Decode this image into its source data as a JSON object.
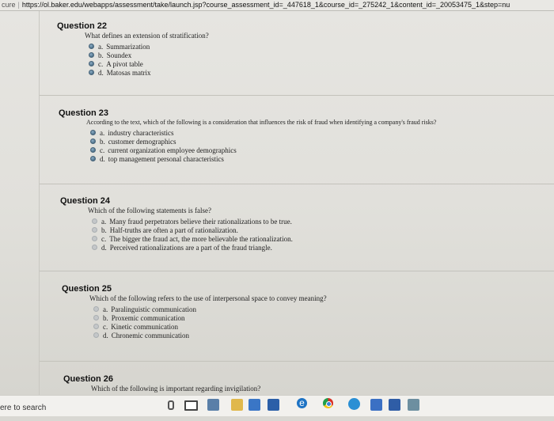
{
  "browser": {
    "secure_label": "cure",
    "url": "https://ol.baker.edu/webapps/assessment/take/launch.jsp?course_assessment_id=_447618_1&course_id=_275242_1&content_id=_20053475_1&step=nu"
  },
  "questions": [
    {
      "title": "Question 22",
      "text": "What defines an extension of stratification?",
      "options": [
        {
          "letter": "a.",
          "text": "Summarization"
        },
        {
          "letter": "b.",
          "text": "Soundex"
        },
        {
          "letter": "c.",
          "text": "A pivot table"
        },
        {
          "letter": "d.",
          "text": "Matosas matrix"
        }
      ]
    },
    {
      "title": "Question 23",
      "text": "According to the text, which of the following is a consideration that influences the risk of fraud when identifying a company's fraud risks?",
      "options": [
        {
          "letter": "a.",
          "text": "industry characteristics"
        },
        {
          "letter": "b.",
          "text": "customer demographics"
        },
        {
          "letter": "c.",
          "text": "current organization employee demographics"
        },
        {
          "letter": "d.",
          "text": "top management personal characteristics"
        }
      ]
    },
    {
      "title": "Question 24",
      "text": "Which of the following statements is false?",
      "options": [
        {
          "letter": "a.",
          "text": "Many fraud perpetrators believe their rationalizations to be true."
        },
        {
          "letter": "b.",
          "text": "Half-truths are often a part of rationalization."
        },
        {
          "letter": "c.",
          "text": "The bigger the fraud act, the more believable the rationalization."
        },
        {
          "letter": "d.",
          "text": "Perceived rationalizations are a part of the fraud triangle."
        }
      ]
    },
    {
      "title": "Question 25",
      "text": "Which of the following refers to the use of interpersonal space to convey meaning?",
      "options": [
        {
          "letter": "a.",
          "text": "Paralinguistic communication"
        },
        {
          "letter": "b.",
          "text": "Proxemic communication"
        },
        {
          "letter": "c.",
          "text": "Kinetic communication"
        },
        {
          "letter": "d.",
          "text": "Chronemic communication"
        }
      ]
    },
    {
      "title": "Question 26",
      "text": "Which of the following is important regarding invigilation?"
    }
  ],
  "taskbar": {
    "search_text": "ere to search",
    "edge_glyph": "e"
  }
}
